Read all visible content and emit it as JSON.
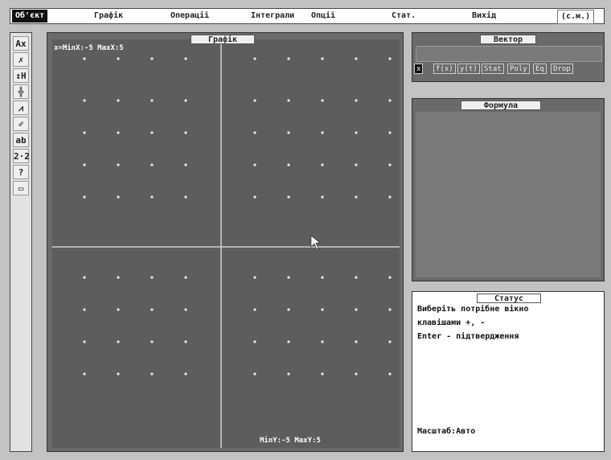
{
  "menu": {
    "items": [
      "Об'єкт",
      "Графік",
      "Операції",
      "Інтеграли",
      "Опції",
      "Стат.",
      "Вихід",
      "(c.м.)"
    ]
  },
  "toolbar": {
    "tools": [
      {
        "label": "Ax",
        "icon": "axis-icon"
      },
      {
        "label": "✗",
        "icon": "cross-icon"
      },
      {
        "label": "↕H",
        "icon": "resize-icon"
      },
      {
        "label": "╬",
        "icon": "grid-icon"
      },
      {
        "label": "⩘",
        "icon": "curve-icon"
      },
      {
        "label": "✐",
        "icon": "pen-icon"
      },
      {
        "label": "ab",
        "icon": "label-icon"
      },
      {
        "label": "2·2",
        "icon": "scale-icon"
      },
      {
        "label": "?",
        "icon": "help-icon"
      },
      {
        "label": "▭",
        "icon": "window-icon"
      }
    ]
  },
  "graph": {
    "title": "Графік",
    "top_range": "x=MinX:-5  MaxX:5",
    "bottom_range": "MinY:-5  MaxY:5"
  },
  "vector": {
    "title": "Вектор",
    "tabs": [
      "x",
      "f(x)",
      "y(t)",
      "Stat",
      "Poly",
      "Eq",
      "Drop"
    ],
    "active_tab": 0
  },
  "formula": {
    "title": "Формула"
  },
  "status": {
    "title": "Статус",
    "lines": [
      "Виберiть потрiбне вiкно",
      "клавiшами +, -",
      "Enter - пiдтвердження"
    ],
    "scale": "Масштаб:Авто"
  },
  "colors": {
    "graph_bg": "#5d5d5d",
    "axis": "#d0d0d0",
    "dots": "#e8e8e8"
  }
}
